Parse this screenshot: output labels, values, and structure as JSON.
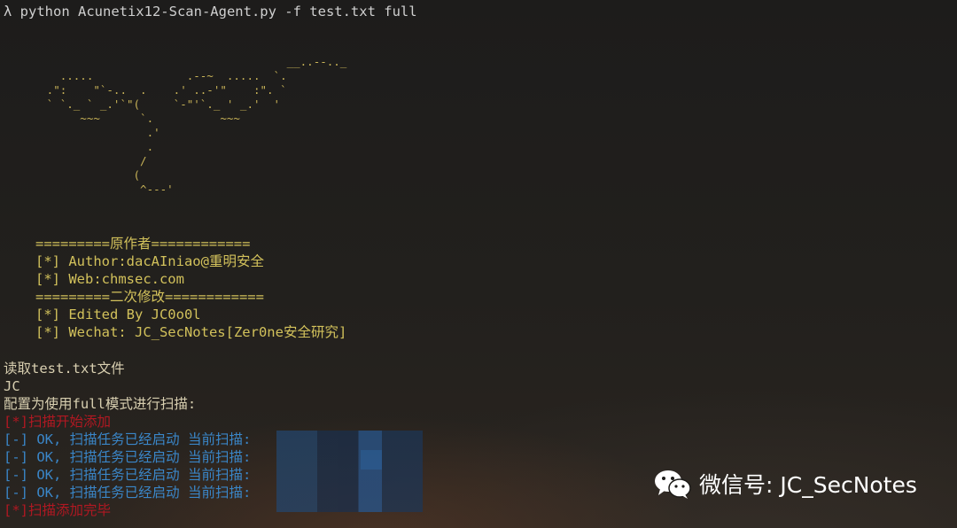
{
  "terminal": {
    "command": "λ python Acunetix12-Scan-Agent.py -f test.txt full",
    "ascii_art": "                                           __..--.._\n         .....              .--~  .....  `.\n       .\":    \"`-..  .    .' ..-'\"    :\". `\n       ` `._ ` _.'`\"(     `-\"'`._ ' _.'  '\n            ~~~      `.          ~~~\n                      .'\n                      .\n                     /\n                    (\n                     ^---'",
    "credits": {
      "header1": "=========原作者============",
      "author": "[*] Author:dacAIniao@重明安全",
      "web": "[*] Web:chmsec.com",
      "header2": "=========二次修改============",
      "edited": "[*] Edited By JC0o0l",
      "wechat": "[*] Wechat: JC_SecNotes[Zer0ne安全研究]"
    },
    "output": [
      {
        "text": "读取test.txt文件",
        "color": "out"
      },
      {
        "text": "JC",
        "color": "out"
      },
      {
        "text": "配置为使用full模式进行扫描:",
        "color": "out"
      },
      {
        "text": "[*]扫描开始添加",
        "color": "red"
      },
      {
        "text": "[-] OK, 扫描任务已经启动 当前扫描:",
        "color": "blue"
      },
      {
        "text": "[-] OK, 扫描任务已经启动 当前扫描:",
        "color": "blue"
      },
      {
        "text": "[-] OK, 扫描任务已经启动 当前扫描:",
        "color": "blue"
      },
      {
        "text": "[-] OK, 扫描任务已经启动 当前扫描:",
        "color": "blue"
      },
      {
        "text": "[*]扫描添加完毕",
        "color": "red"
      }
    ]
  },
  "watermark": {
    "text": "微信号: JC_SecNotes",
    "icon": "wechat-icon"
  },
  "colors": {
    "background": "#1c1b19",
    "ascii": "#c9b458",
    "credits": "#d2c15b",
    "red": "#b01822",
    "blue": "#3a86c8"
  }
}
